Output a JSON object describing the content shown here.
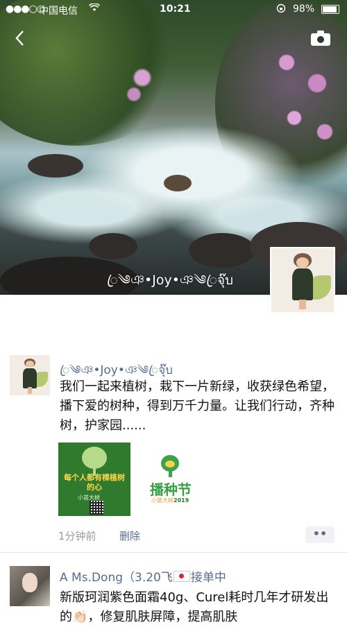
{
  "status_bar": {
    "signal": "●●●○○",
    "carrier": "中国电信",
    "wifi_icon": "wifi-icon",
    "time": "10:21",
    "battery_percent": "98%"
  },
  "header": {
    "back_icon": "back-arrow-icon",
    "camera_icon": "camera-icon",
    "cover_name": "ꦿ༄ঞ•Joy•ঞ༄ꦿจุ๊บ"
  },
  "posts": [
    {
      "name": "ꦿ༄ঞ•Joy•ঞ༄ꦿจุ๊บ",
      "text": "我们一起来植树，栽下一片新绿，收获绿色希望，播下爱的树种，得到万千力量。让我们行动，齐种树，护家园......",
      "images": [
        {
          "text": "每个人都有棵植树的心",
          "brand": "小苗大树"
        },
        {
          "title": "播种节",
          "brand": "小苗大树",
          "year": "2019"
        }
      ],
      "time": "1分钟前",
      "delete_label": "删除",
      "more_label": "••"
    },
    {
      "name_prefix": "A Ms.Dong（3.20飞",
      "name_suffix": "接单中",
      "text": "新版珂润紫色面霜40g、Curel耗时几年才研发出的👏🏻，修复肌肤屏障，提高肌肤"
    }
  ],
  "colors": {
    "link": "#576b95",
    "meta": "#9b9b9b",
    "divider": "#e3e3e3"
  }
}
